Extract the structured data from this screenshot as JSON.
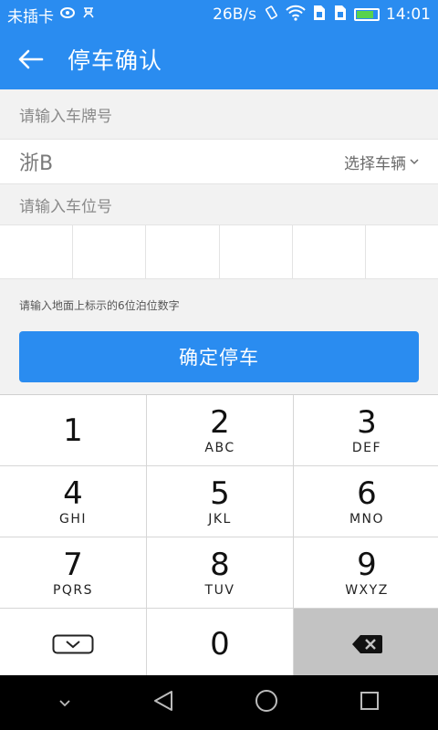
{
  "status_bar": {
    "carrier": "未插卡",
    "net_speed": "26B/s",
    "time": "14:01",
    "battery_level": 0.82
  },
  "header": {
    "title": "停车确认"
  },
  "form": {
    "plate_label": "请输入车牌号",
    "plate_value": "浙B",
    "select_vehicle_label": "选择车辆",
    "slot_label": "请输入车位号",
    "slot_cells": [
      "",
      "",
      "",
      "",
      "",
      ""
    ],
    "hint": "请输入地面上标示的6位泊位数字",
    "confirm_label": "确定停车"
  },
  "keypad": {
    "keys": [
      {
        "num": "1",
        "letters": ""
      },
      {
        "num": "2",
        "letters": "ABC"
      },
      {
        "num": "3",
        "letters": "DEF"
      },
      {
        "num": "4",
        "letters": "GHI"
      },
      {
        "num": "5",
        "letters": "JKL"
      },
      {
        "num": "6",
        "letters": "MNO"
      },
      {
        "num": "7",
        "letters": "PQRS"
      },
      {
        "num": "8",
        "letters": "TUV"
      },
      {
        "num": "9",
        "letters": "WXYZ"
      },
      {
        "num": "0",
        "letters": ""
      }
    ]
  },
  "colors": {
    "accent": "#2a8cf0",
    "battery": "#58d24e"
  },
  "icons": [
    "back-arrow-icon",
    "chevron-down-icon",
    "hide-keyboard-icon",
    "backspace-icon",
    "nav-back-icon",
    "nav-home-icon",
    "nav-recents-icon",
    "nav-collapse-icon"
  ]
}
